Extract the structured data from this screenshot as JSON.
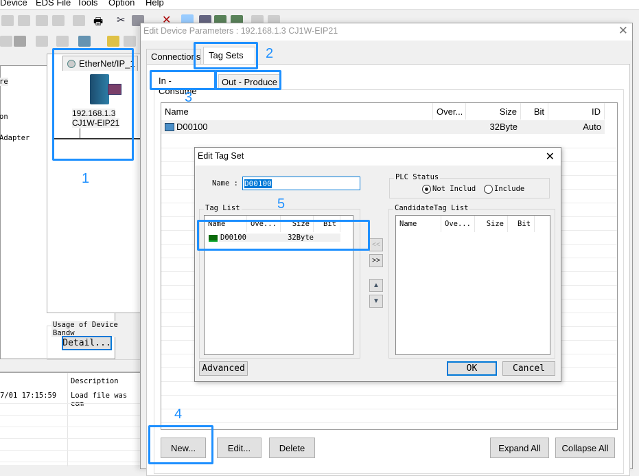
{
  "menu": [
    "Device",
    "EDS File",
    "Tools",
    "Option",
    "Help"
  ],
  "left_panel": {
    "items": [
      "re",
      "on",
      "Adapter"
    ]
  },
  "network": {
    "tab": "EtherNet/IP_1",
    "device_ip": "192.168.1.3",
    "device_model": "CJ1W-EIP21"
  },
  "bandwidth": {
    "label": "Usage of Device Bandw",
    "detail_button": "Detail..."
  },
  "log": {
    "columns": [
      "",
      "Description"
    ],
    "rows": [
      [
        "7/01 17:15:59",
        "Load file was com"
      ]
    ]
  },
  "edit_device": {
    "title": "Edit Device Parameters : 192.168.1.3 CJ1W-EIP21",
    "tabs": [
      "Connections",
      "Tag Sets"
    ],
    "active_tab": "Tag Sets",
    "subtabs": [
      "In - Consume",
      "Out - Produce"
    ],
    "active_subtab": "In - Consume",
    "columns": [
      "Name",
      "Over...",
      "Size",
      "Bit",
      "ID"
    ],
    "rows": [
      {
        "name": "D00100",
        "over": "",
        "size": "32Byte",
        "bit": "",
        "id": "Auto"
      }
    ],
    "buttons": {
      "new": "New...",
      "edit": "Edit...",
      "delete": "Delete",
      "expand": "Expand All",
      "collapse": "Collapse All"
    }
  },
  "edit_tag_set": {
    "title": "Edit Tag Set",
    "name_label": "Name :",
    "name_value": "D00100",
    "plc_status": {
      "label": "PLC Status",
      "options": [
        "Not Includ",
        "Include"
      ],
      "selected": "Not Includ"
    },
    "tag_list": {
      "label": "Tag List",
      "columns": [
        "Name",
        "Ove...",
        "Size",
        "Bit"
      ],
      "rows": [
        {
          "name": "D00100",
          "over": "",
          "size": "32Byte",
          "bit": ""
        }
      ]
    },
    "candidate_list": {
      "label": "CandidateTag List",
      "columns": [
        "Name",
        "Ove...",
        "Size",
        "Bit"
      ],
      "rows": []
    },
    "move_left": "<<",
    "move_right": ">>",
    "buttons": {
      "advanced": "Advanced",
      "ok": "OK",
      "cancel": "Cancel"
    }
  },
  "annotations": [
    "1",
    "2",
    "3",
    "4",
    "5"
  ],
  "colors": {
    "annotation": "#1e90ff",
    "selection": "#0078d7"
  }
}
